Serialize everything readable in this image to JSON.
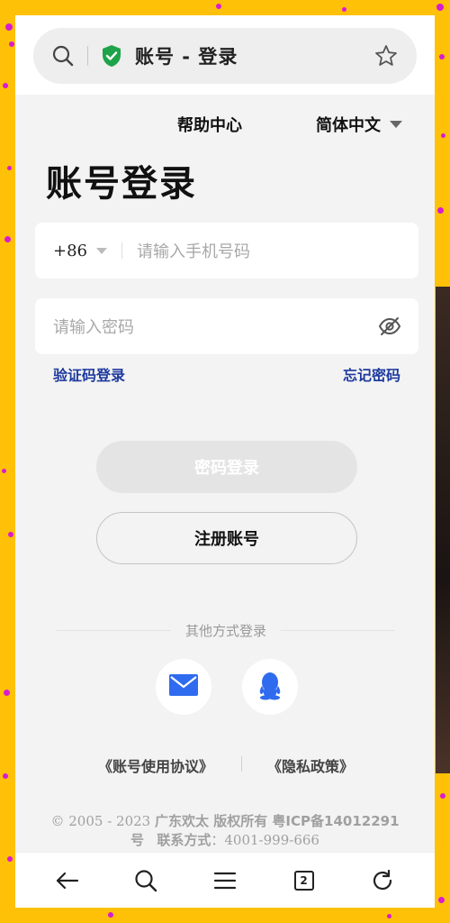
{
  "browser": {
    "page_title": "账号 - 登录",
    "tab_count": "2",
    "icons": {
      "search": "search-icon",
      "secure": "shield-check-icon",
      "bookmark": "star-icon"
    }
  },
  "header": {
    "help_label": "帮助中心",
    "language_label": "简体中文"
  },
  "login": {
    "title": "账号登录",
    "country_code": "+86",
    "phone_placeholder": "请输入手机号码",
    "password_placeholder": "请输入密码",
    "sms_login_label": "验证码登录",
    "forgot_password_label": "忘记密码",
    "login_button_label": "密码登录",
    "register_button_label": "注册账号"
  },
  "other_login": {
    "label": "其他方式登录",
    "methods": [
      "mail-icon",
      "qq-icon"
    ]
  },
  "footer": {
    "agreement_label": "《账号使用协议》",
    "privacy_label": "《隐私政策》",
    "copyright_years": "© 2005 - 2023 ",
    "copyright_company": "广东欢太 版权所有 粤ICP备14012291号",
    "contact_label": "联系方式",
    "contact_value": "：4001-999-666"
  },
  "colors": {
    "page_background": "#FFC107",
    "dots": "#D81BD2",
    "link": "#1E3A9E",
    "mail_icon": "#2F6BEF",
    "qq_icon": "#2F6BEF"
  }
}
